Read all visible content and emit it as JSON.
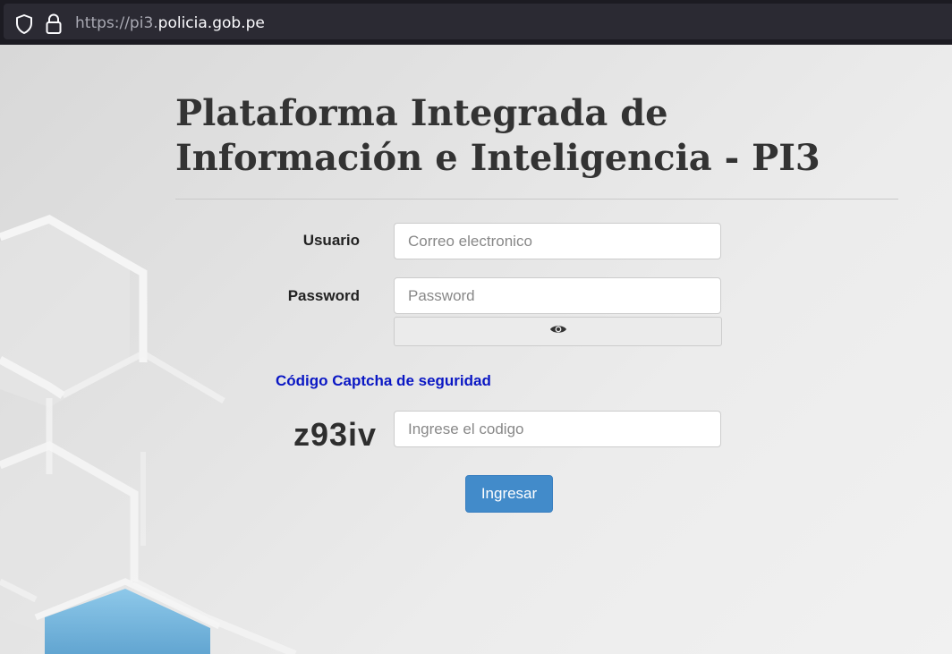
{
  "browser": {
    "url_prefix": "https://pi3.",
    "url_domain": "policia.gob.pe",
    "shield_icon": "shield-icon",
    "lock_icon": "lock-icon"
  },
  "page": {
    "title": "Plataforma Integrada de Información e Inteligencia - PI3"
  },
  "form": {
    "usuario_label": "Usuario",
    "usuario_placeholder": "Correo electronico",
    "password_label": "Password",
    "password_placeholder": "Password",
    "show_password_icon": "eye-icon",
    "captcha_heading": "Código Captcha de seguridad",
    "captcha_code": "z93iv",
    "captcha_placeholder": "Ingrese el codigo",
    "submit_label": "Ingresar"
  },
  "colors": {
    "accent": "#428bca",
    "captcha_heading": "#0a17c4",
    "title": "#333333"
  }
}
